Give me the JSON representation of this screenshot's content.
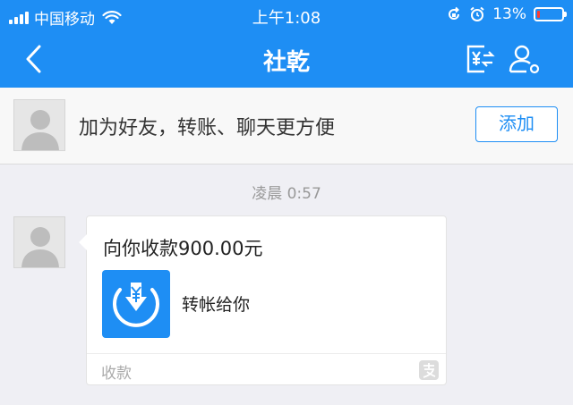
{
  "status_bar": {
    "carrier": "中国移动",
    "time": "上午1:08",
    "battery": "13%",
    "battery_level": 0.13
  },
  "nav": {
    "title": "社乾",
    "back_icon": "chevron-left-icon",
    "transfer_icon": "transfer-yuan-icon",
    "profile_icon": "profile-settings-icon"
  },
  "banner": {
    "text": "加为好友，转账、聊天更方便",
    "add_label": "添加"
  },
  "chat": {
    "timestamp": "凌晨 0:57",
    "message": {
      "title": "向你收款900.00元",
      "description": "转帐给你",
      "footer": "收款"
    }
  },
  "colors": {
    "accent": "#1e8ef4",
    "background": "#efeff4",
    "battery_low": "#ff3b30"
  }
}
